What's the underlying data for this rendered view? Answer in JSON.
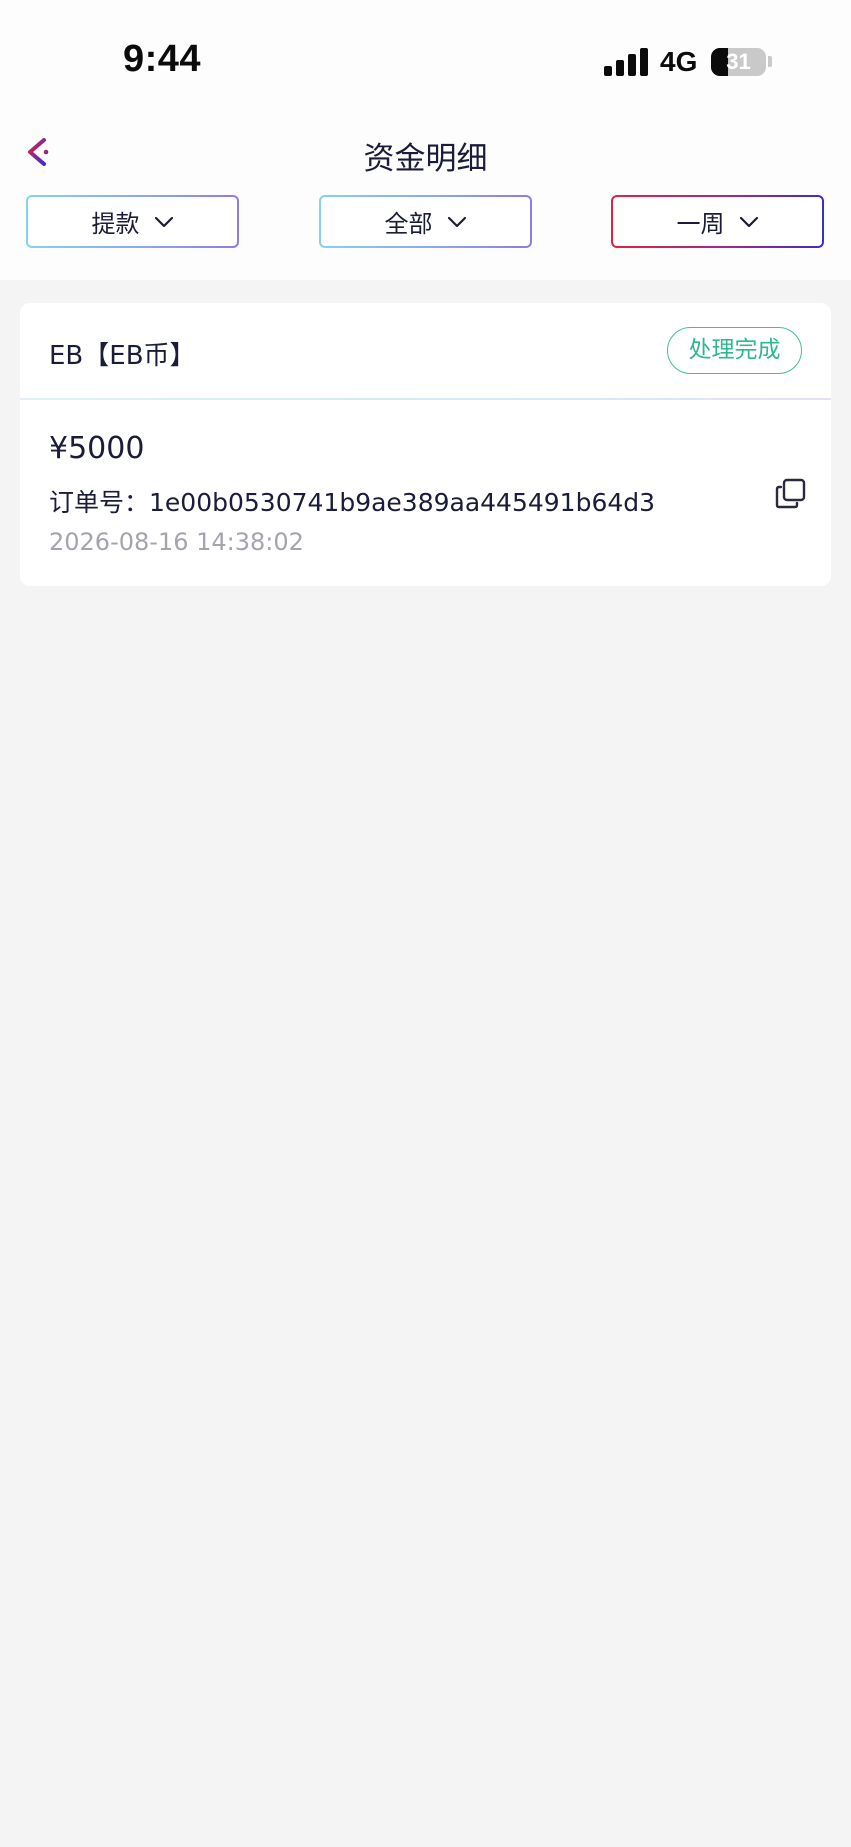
{
  "status_bar": {
    "time": "9:44",
    "network": "4G",
    "battery": "31",
    "battery_level": 0.31
  },
  "nav": {
    "title": "资金明细",
    "back_icon": "chevron-left-icon"
  },
  "filters": [
    {
      "label": "提款",
      "icon": "chevron-down-icon"
    },
    {
      "label": "全部",
      "icon": "chevron-down-icon"
    },
    {
      "label": "一周",
      "icon": "chevron-down-icon"
    }
  ],
  "record": {
    "coin": "EB【EB币】",
    "status": "处理完成",
    "amount": "¥5000",
    "order_label": "订单号：",
    "order_id": "1e00b0530741b9ae389aa445491b64d3",
    "date": "2026-08-16 14:38:02",
    "copy_icon": "copy-icon"
  },
  "colors": {
    "background": "#f4f4f5",
    "header_background": "#fdfdfd",
    "card_background": "#ffffff",
    "text_primary": "#1b1b3a",
    "text_secondary": "#a4a4ad",
    "status_green": "#2fb892",
    "back_gradient_start": "#e5213f",
    "back_gradient_end": "#3c2ad4"
  }
}
